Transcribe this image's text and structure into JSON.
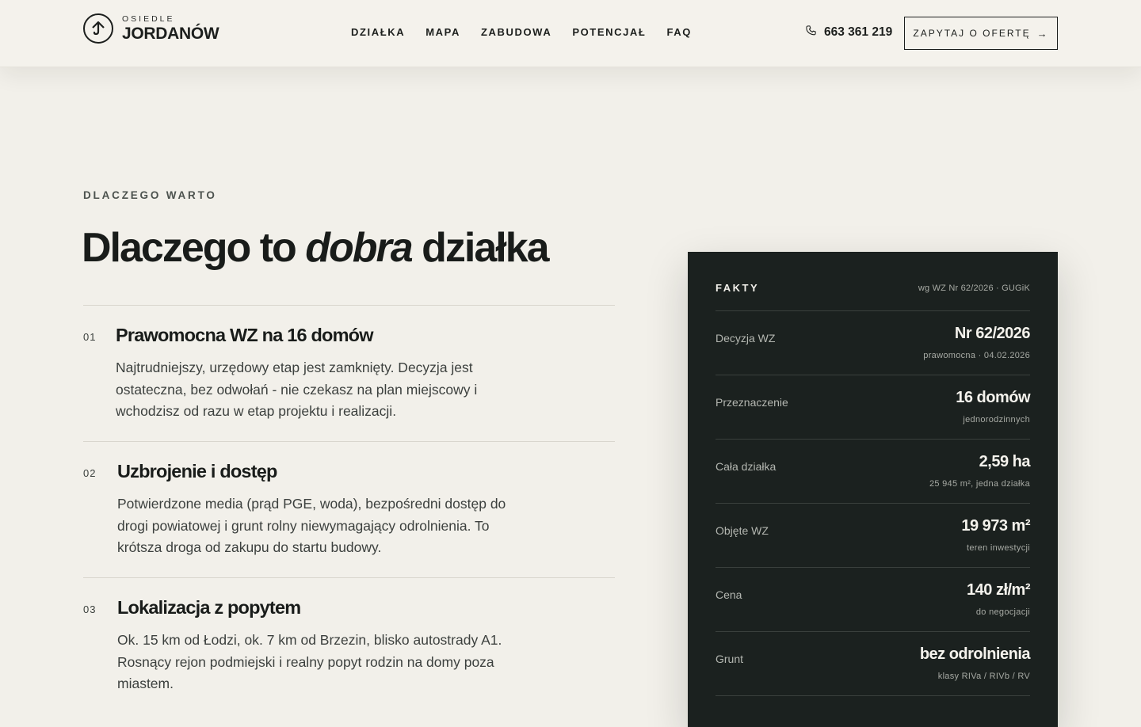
{
  "header": {
    "logo_small": "OSIEDLE",
    "logo_big": "JORDANÓW",
    "nav": [
      "DZIAŁKA",
      "MAPA",
      "ZABUDOWA",
      "POTENCJAŁ",
      "FAQ"
    ],
    "phone": "663 361 219",
    "cta_label": "ZAPYTAJ O OFERTĘ"
  },
  "section": {
    "eyebrow": "DLACZEGO WARTO",
    "title_pre": "Dlaczego to ",
    "title_em": "dobra",
    "title_post": " działka",
    "features": [
      {
        "num": "01",
        "title": "Prawomocna WZ na 16 domów",
        "text": "Najtrudniejszy, urzędowy etap jest zamknięty. Decyzja jest ostateczna, bez odwołań - nie czekasz na plan miejscowy i wchodzisz od razu w etap projektu i realizacji."
      },
      {
        "num": "02",
        "title": "Uzbrojenie i dostęp",
        "text": "Potwierdzone media (prąd PGE, woda), bezpośredni dostęp do drogi powiatowej i grunt rolny niewymagający odrolnienia. To krótsza droga od zakupu do startu budowy."
      },
      {
        "num": "03",
        "title": "Lokalizacja z popytem",
        "text": "Ok. 15 km od Łodzi, ok. 7 km od Brzezin, blisko autostrady A1. Rosnący rejon podmiejski i realny popyt rodzin na domy poza miastem."
      }
    ]
  },
  "facts": {
    "label": "FAKTY",
    "source": "wg WZ Nr 62/2026 · GUGiK",
    "rows": [
      {
        "key": "Decyzja WZ",
        "value": "Nr 62/2026",
        "sub": "prawomocna · 04.02.2026"
      },
      {
        "key": "Przeznaczenie",
        "value": "16 domów",
        "sub": "jednorodzinnych"
      },
      {
        "key": "Cała działka",
        "value": "2,59 ha",
        "sub": "25 945 m², jedna działka"
      },
      {
        "key": "Objęte WZ",
        "value": "19 973 m²",
        "sub": "teren inwestycji"
      },
      {
        "key": "Cena",
        "value": "140 zł/m²",
        "sub": "do negocjacji"
      },
      {
        "key": "Grunt",
        "value": "bez odrolnienia",
        "sub": "klasy RIVa / RIVb / RV"
      }
    ]
  }
}
